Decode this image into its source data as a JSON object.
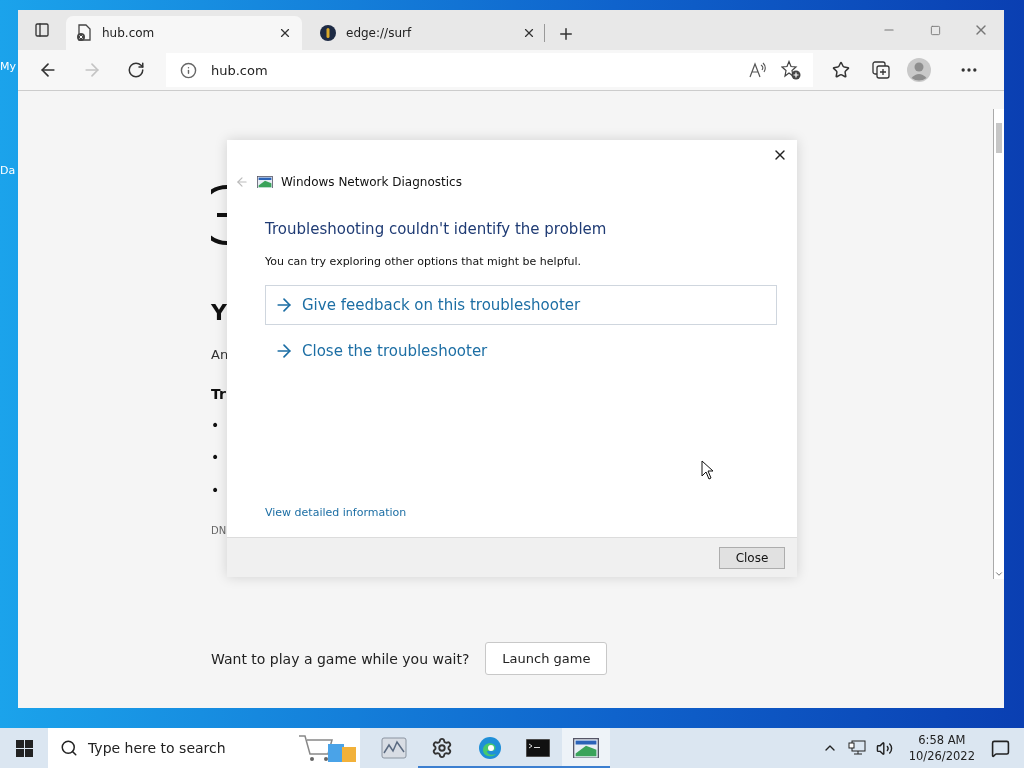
{
  "desktop": {
    "icon_labels": [
      "My",
      "Da"
    ]
  },
  "browser": {
    "tabs": [
      {
        "title": "hub.com",
        "selected": true
      },
      {
        "title": "edge://surf",
        "selected": false
      }
    ],
    "navigation": {
      "forward_enabled": false
    },
    "address": "hub.com",
    "page": {
      "heading": "Y",
      "text": "An",
      "subheading": "Tr",
      "bullets": [
        "•",
        "•",
        "•"
      ],
      "footnote": "DN",
      "game_prompt": "Want to play a game while you wait?",
      "game_button": "Launch game"
    }
  },
  "dialog": {
    "title": "Windows Network Diagnostics",
    "heading": "Troubleshooting couldn't identify the problem",
    "description": "You can try exploring other options that might be helpful.",
    "options": [
      {
        "label": "Give feedback on this troubleshooter",
        "selected": true
      },
      {
        "label": "Close the troubleshooter",
        "selected": false
      }
    ],
    "link": "View detailed information",
    "button": "Close"
  },
  "taskbar": {
    "search_placeholder": "Type here to search",
    "apps": [
      {
        "kind": "monitor",
        "running": false,
        "selected": false
      },
      {
        "kind": "settings",
        "running": true,
        "selected": false
      },
      {
        "kind": "edge",
        "running": true,
        "selected": false
      },
      {
        "kind": "terminal",
        "running": true,
        "selected": false
      },
      {
        "kind": "diagnostics",
        "running": true,
        "selected": true
      }
    ],
    "time": "6:58 AM",
    "date": "10/26/2022"
  }
}
